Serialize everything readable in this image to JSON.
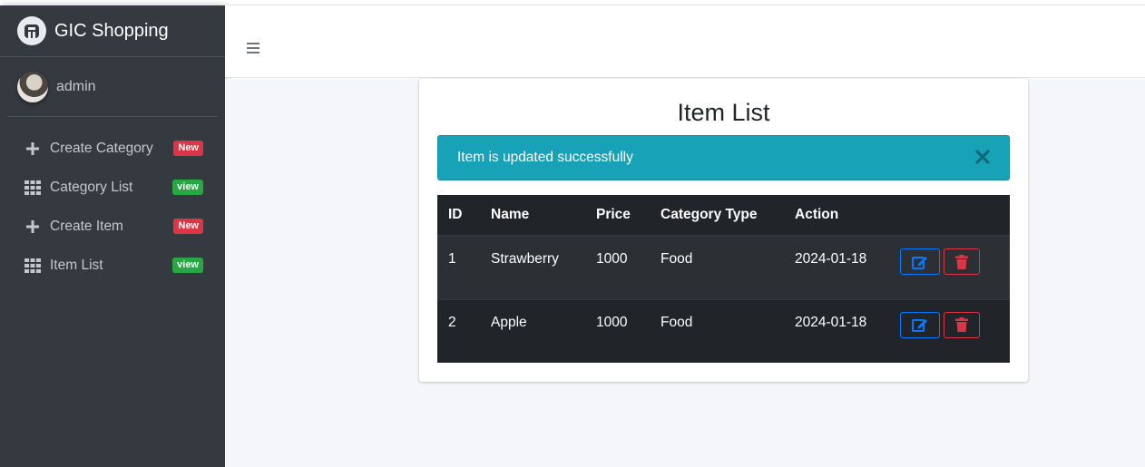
{
  "brand": {
    "name": "GIC Shopping",
    "logo_icon": "brand-logo-icon"
  },
  "user": {
    "name": "admin"
  },
  "sidebar": {
    "items": [
      {
        "label": "Create Category",
        "icon": "plus-icon",
        "badge": "New",
        "badge_color": "#dc3545"
      },
      {
        "label": "Category List",
        "icon": "grid-icon",
        "badge": "view",
        "badge_color": "#28a745"
      },
      {
        "label": "Create Item",
        "icon": "plus-icon",
        "badge": "New",
        "badge_color": "#dc3545"
      },
      {
        "label": "Item List",
        "icon": "grid-icon",
        "badge": "view",
        "badge_color": "#28a745"
      }
    ]
  },
  "main": {
    "title": "Item List",
    "alert": {
      "message": "Item is updated successfully",
      "color": "#17a2b8"
    },
    "table": {
      "headers": [
        "ID",
        "Name",
        "Price",
        "Category Type",
        "Action"
      ],
      "rows": [
        {
          "id": "1",
          "name": "Strawberry",
          "price": "1000",
          "category": "Food",
          "date": "2024-01-18"
        },
        {
          "id": "2",
          "name": "Apple",
          "price": "1000",
          "category": "Food",
          "date": "2024-01-18"
        }
      ]
    }
  }
}
